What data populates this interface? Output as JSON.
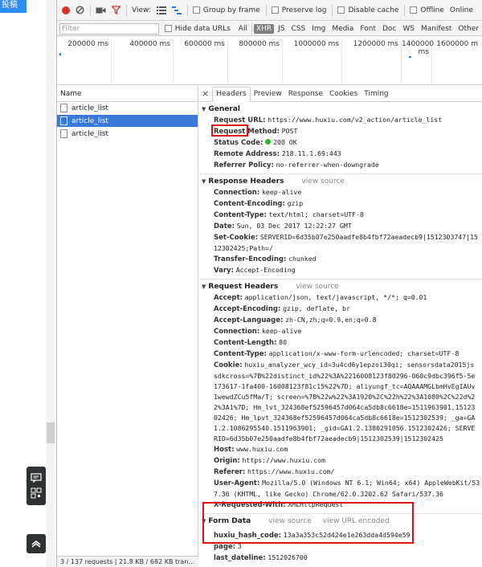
{
  "page": {
    "tab_label": "投稿"
  },
  "toolbar": {
    "view_label": "View:",
    "group_by_frame": "Group by frame",
    "preserve_log": "Preserve log",
    "disable_cache": "Disable cache",
    "offline": "Offline",
    "throttle": "Online"
  },
  "filterbar": {
    "filter_placeholder": "Filter",
    "hide_data_urls": "Hide data URLs",
    "types": [
      "All",
      "XHR",
      "JS",
      "CSS",
      "Img",
      "Media",
      "Font",
      "Doc",
      "WS",
      "Manifest",
      "Other"
    ],
    "active_type": "XHR"
  },
  "overview": {
    "ticks": [
      "200000 ms",
      "400000 ms",
      "600000 ms",
      "800000 ms",
      "1000000 ms",
      "1200000 ms",
      "1400000 ms",
      "1600000 m"
    ]
  },
  "requests": {
    "header": "Name",
    "rows": [
      "article_list",
      "article_list",
      "article_list"
    ],
    "selected_index": 1,
    "status": "3 / 137 requests | 21.8 KB / 682 KB tran..."
  },
  "details": {
    "close": "×",
    "tabs": [
      "Headers",
      "Preview",
      "Response",
      "Cookies",
      "Timing"
    ],
    "active_tab": "Headers",
    "general": {
      "title": "General",
      "request_url_k": "Request URL:",
      "request_url_v": "https://www.huxiu.com/v2_action/article_list",
      "method_k": "Request Method:",
      "method_v": "POST",
      "status_k": "Status Code:",
      "status_v": "200 OK",
      "remote_k": "Remote Address:",
      "remote_v": "218.11.1.69:443",
      "referrer_k": "Referrer Policy:",
      "referrer_v": "no-referrer-when-downgrade"
    },
    "response_headers": {
      "title": "Response Headers",
      "view_source": "view source",
      "connection_k": "Connection:",
      "connection_v": "keep-alive",
      "encoding_k": "Content-Encoding:",
      "encoding_v": "gzip",
      "type_k": "Content-Type:",
      "type_v": "text/html; charset=UTF-8",
      "date_k": "Date:",
      "date_v": "Sun, 03 Dec 2017 12:22:27 GMT",
      "cookie_k": "Set-Cookie:",
      "cookie_v": "SERVERID=6d35b07e250aadfe8b4fbf72aeadecb9|1512303747|15",
      "cookie_v2": "12302425;Path=/",
      "te_k": "Transfer-Encoding:",
      "te_v": "chunked",
      "vary_k": "Vary:",
      "vary_v": "Accept-Encoding"
    },
    "request_headers": {
      "title": "Request Headers",
      "view_source": "view source",
      "accept_k": "Accept:",
      "accept_v": "application/json, text/javascript, */*; q=0.01",
      "accept_enc_k": "Accept-Encoding:",
      "accept_enc_v": "gzip, deflate, br",
      "accept_lang_k": "Accept-Language:",
      "accept_lang_v": "zh-CN,zh;q=0.9,en;q=0.8",
      "connection_k": "Connection:",
      "connection_v": "keep-alive",
      "length_k": "Content-Length:",
      "length_v": "80",
      "ctype_k": "Content-Type:",
      "ctype_v": "application/x-www-form-urlencoded; charset=UTF-8",
      "cookie_k": "Cookie:",
      "cookie_v": "huxiu_analyzer_wcy_id=3u4cd6y1epzoi30qi; sensorsdata2015js",
      "cookie_lines": [
        "sdkcross=%7B%22distinct_id%22%3A%2216008123f80296-060c9dbc396f5-5e",
        "173617-1fa400-16008123f81c15%22%7D; aliyungf_tc=AQAAAMGLbmHvEgIAUv",
        "1wewdZCu5fMa/T; screen=%7B%22w%22%3A1920%2C%22h%22%3A1080%2C%22d%2",
        "2%3A1%7D; Hm_lvt_324368ef52596457d064ca5db8c6618e=1511963901,15123",
        "02426; Hm_lpvt_324368ef52596457d064ca5db8c6618e=1512302539; _ga=GA",
        "1.2.1086295540.1511963901; _gid=GA1.2.1380291056.1512302426; SERVE",
        "RID=6d35b07e250aadfe8b4fbf72aeadecb9|1512302539|1512302425"
      ],
      "host_k": "Host:",
      "host_v": "www.huxiu.com",
      "origin_k": "Origin:",
      "origin_v": "https://www.huxiu.com",
      "referer_k": "Referer:",
      "referer_v": "https://www.huxiu.com/",
      "ua_k": "User-Agent:",
      "ua_v": "Mozilla/5.0 (Windows NT 6.1; Win64; x64) AppleWebKit/53",
      "ua_v2": "7.36 (KHTML, like Gecko) Chrome/62.0.3202.62 Safari/537.36",
      "xrw_k": "X-Requested-With:",
      "xrw_v": "XMLHttpRequest"
    },
    "form_data": {
      "title": "Form Data",
      "view_source": "view source",
      "view_url_encoded": "view URL encoded",
      "hash_k": "huxiu_hash_code:",
      "hash_v": "13a3a353c52d424e1e263dda4d594e59",
      "page_k": "page:",
      "page_v": "3",
      "dateline_k": "last_dateline:",
      "dateline_v": "1512026700"
    }
  },
  "colors": {
    "highlight_box": "#e0101a",
    "selected_row": "#3879d9",
    "record": "#d9302c"
  }
}
